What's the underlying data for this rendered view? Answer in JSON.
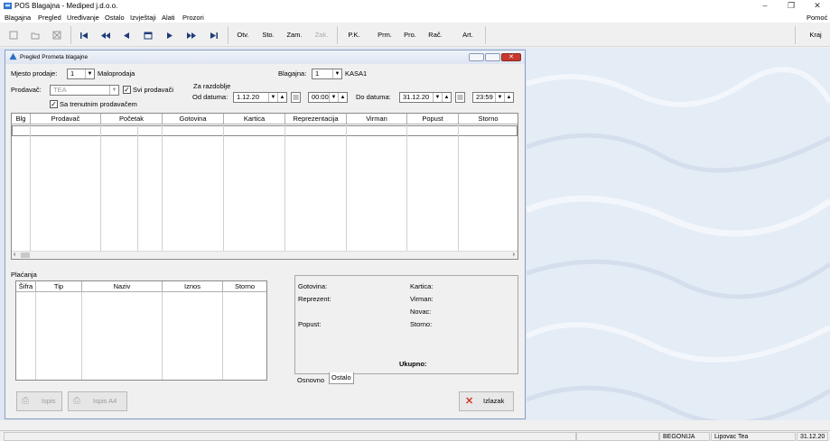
{
  "window": {
    "title": "POS Blagajna - Mediped j.d.o.o.",
    "minimize": "–",
    "restore": "❐",
    "close": "✕"
  },
  "menu": {
    "items": [
      "Blagajna",
      "Pregled",
      "Uređivanje",
      "Ostalo",
      "Izvještaji",
      "Alati",
      "Prozori"
    ],
    "help": "Pomoć"
  },
  "toolbar": {
    "buttons": [
      "Otv.",
      "Sto.",
      "Zam.",
      "Zak.",
      "P.K.",
      "Prm.",
      "Pro.",
      "Rač.",
      "Art."
    ],
    "exit": "Kraj"
  },
  "child": {
    "title": "Pregled Prometa blagajne",
    "mjesto_label": "Mjesto prodaje:",
    "mjesto_value": "1",
    "mjesto_name": "Maloprodaja",
    "blagajna_label": "Blagajna:",
    "blagajna_value": "1",
    "blagajna_name": "KASA1",
    "prodavac_label": "Prodavač:",
    "prodavac_value": "TEA",
    "svi_label": "Svi prodavači",
    "trenutni_label": "Sa trenutnim prodavačem",
    "razdoblje_label": "Za razdoblje",
    "od_label": "Od datuma:",
    "od_date": "1.12.20",
    "od_time": "00:00",
    "do_label": "Do datuma:",
    "do_date": "31.12.20",
    "do_time": "23:59",
    "grid_columns": [
      "Blg",
      "Prodavač",
      "Početak",
      "",
      "Gotovina",
      "Kartica",
      "Reprezentacija",
      "Virman",
      "Popust",
      "Storno"
    ],
    "placanja_label": "Plaćanja",
    "pay_columns": [
      "Šifra",
      "Tip",
      "Naziv",
      "Iznos",
      "Storno"
    ],
    "summary": {
      "gotovina": "Gotovina:",
      "kartica": "Kartica:",
      "reprezent": "Reprezent:",
      "virman": "Virman:",
      "novac": "Novac:",
      "popust": "Popust:",
      "storno": "Storno:",
      "ukupno": "Ukupno:"
    },
    "tabs": [
      "Osnovno",
      "Ostalo"
    ],
    "buttons": {
      "ispis": "Ispis",
      "ispis_a4": "Ispis A4",
      "izlazak": "Izlazak"
    }
  },
  "status": {
    "location": "BEGONIJA",
    "user": "Lipovac Tea",
    "date": "31.12.20"
  },
  "colors": {
    "accent": "#1e5aa8",
    "close_red": "#c8372d",
    "desktop": "#e4ecf6"
  }
}
